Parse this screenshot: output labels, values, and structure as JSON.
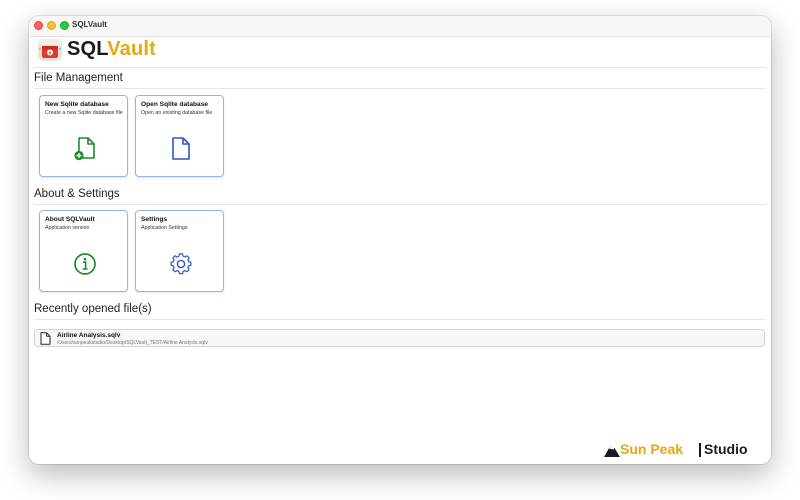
{
  "window": {
    "title": "SQLVault"
  },
  "brand": {
    "name_part1": "SQL",
    "name_part2": "Vault",
    "logo_icon": "vault-logo-icon"
  },
  "sections": {
    "file_management": "File Management",
    "about_settings": "About & Settings",
    "recent": "Recently opened file(s)"
  },
  "cards": {
    "new_db": {
      "title": "New Sqlite database",
      "subtitle": "Create a new Sqlite database file",
      "icon": "file-add-icon",
      "color": "#1e8a2e"
    },
    "open_db": {
      "title": "Open Sqlite database",
      "subtitle": "Open an existing database file",
      "icon": "file-icon",
      "color": "#2a57c9"
    },
    "about": {
      "title": "About SQLVault",
      "subtitle": "Application version",
      "icon": "info-icon",
      "color": "#1e8a2e"
    },
    "settings": {
      "title": "Settings",
      "subtitle": "Application Settings",
      "icon": "gear-icon",
      "color": "#2a57c9"
    }
  },
  "recent_files": [
    {
      "name": "Airline Analysis.sqlv",
      "path": "/Users/sunpeakstudio/Desktop/SQLVault_TEST/Airline Analysis.sqlv"
    }
  ],
  "footer": {
    "brand_part1": "Sun Peak",
    "brand_part2": "Studio",
    "accent_color": "#e8a710"
  }
}
